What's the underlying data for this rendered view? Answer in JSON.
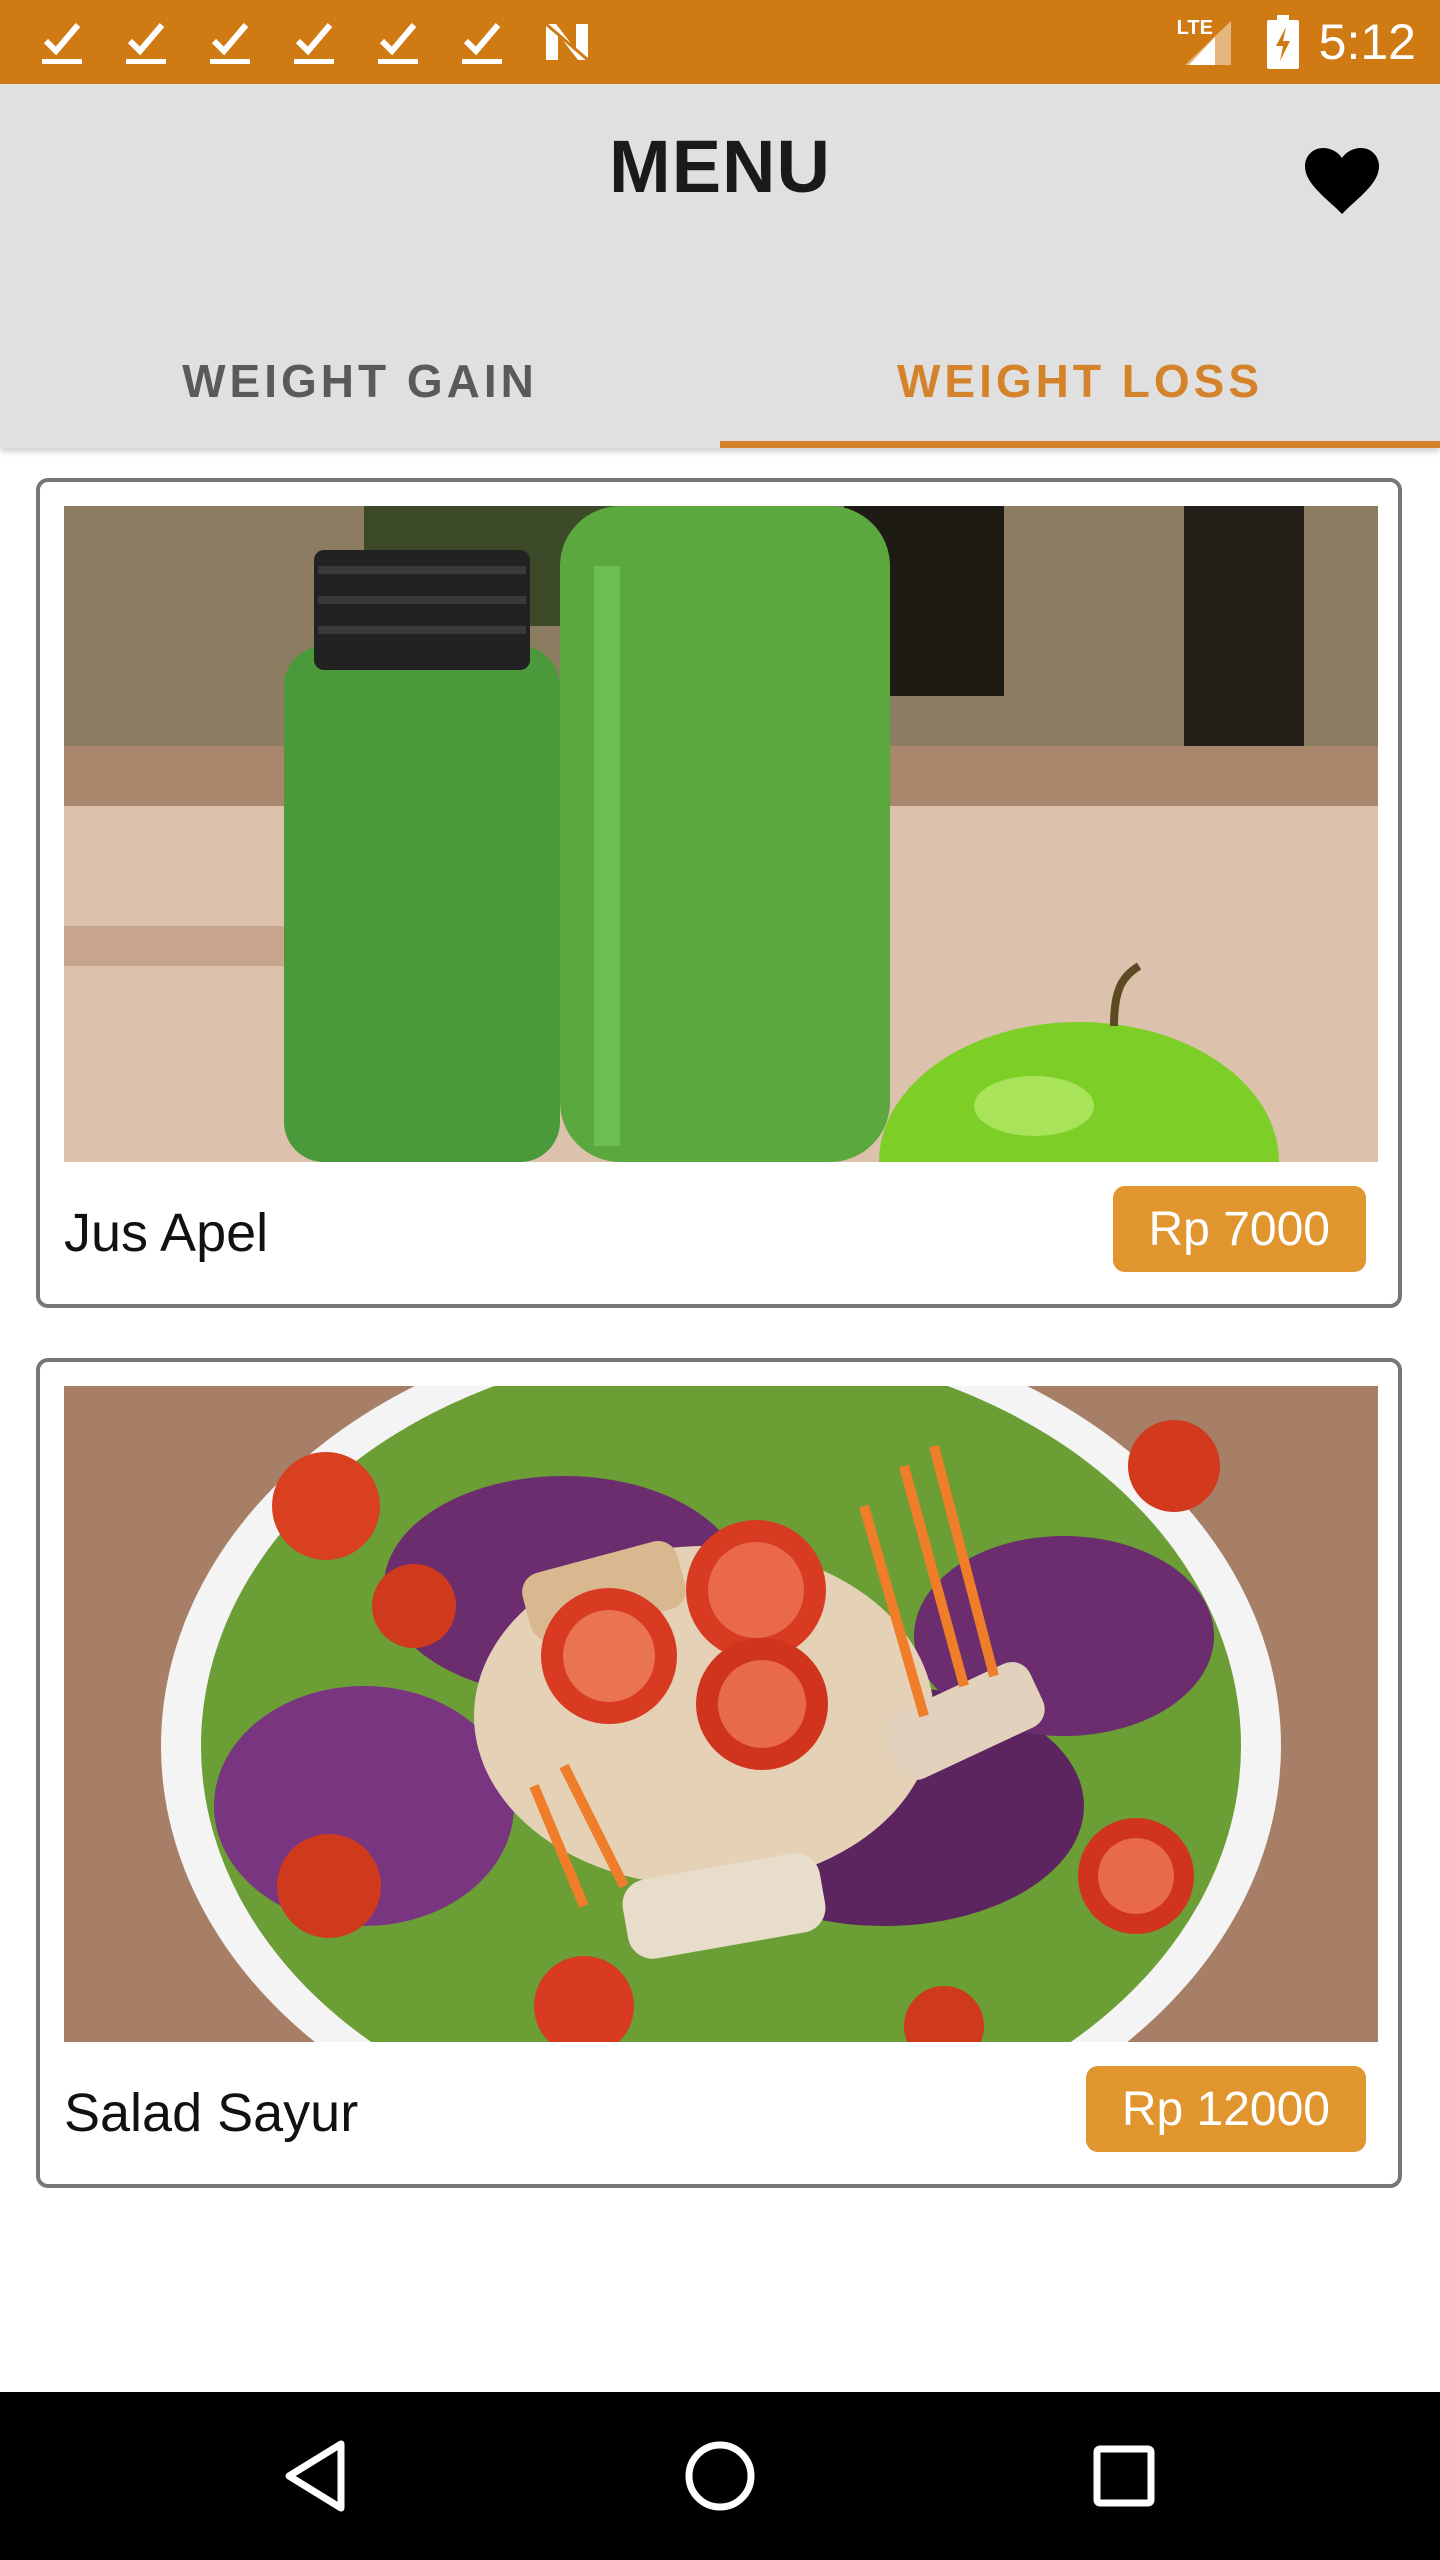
{
  "status_bar": {
    "time": "5:12",
    "network": "LTE",
    "notification_icons": [
      "check-icon",
      "check-icon",
      "check-icon",
      "check-icon",
      "check-icon",
      "check-icon",
      "n-logo-icon"
    ]
  },
  "header": {
    "title": "MENU",
    "favorite_icon": "heart-icon"
  },
  "tabs": [
    {
      "label": "WEIGHT GAIN",
      "active": false
    },
    {
      "label": "WEIGHT LOSS",
      "active": true
    }
  ],
  "menu_items": [
    {
      "name": "Jus Apel",
      "price": "Rp 7000"
    },
    {
      "name": "Salad Sayur",
      "price": "Rp 12000"
    }
  ],
  "nav": {
    "back_icon": "back-triangle-icon",
    "home_icon": "home-circle-icon",
    "recents_icon": "recents-square-icon"
  },
  "colors": {
    "status_bar": "#cf7a13",
    "accent": "#d5832a",
    "price_badge": "#e0952e",
    "app_bar": "#e0e0e0"
  }
}
